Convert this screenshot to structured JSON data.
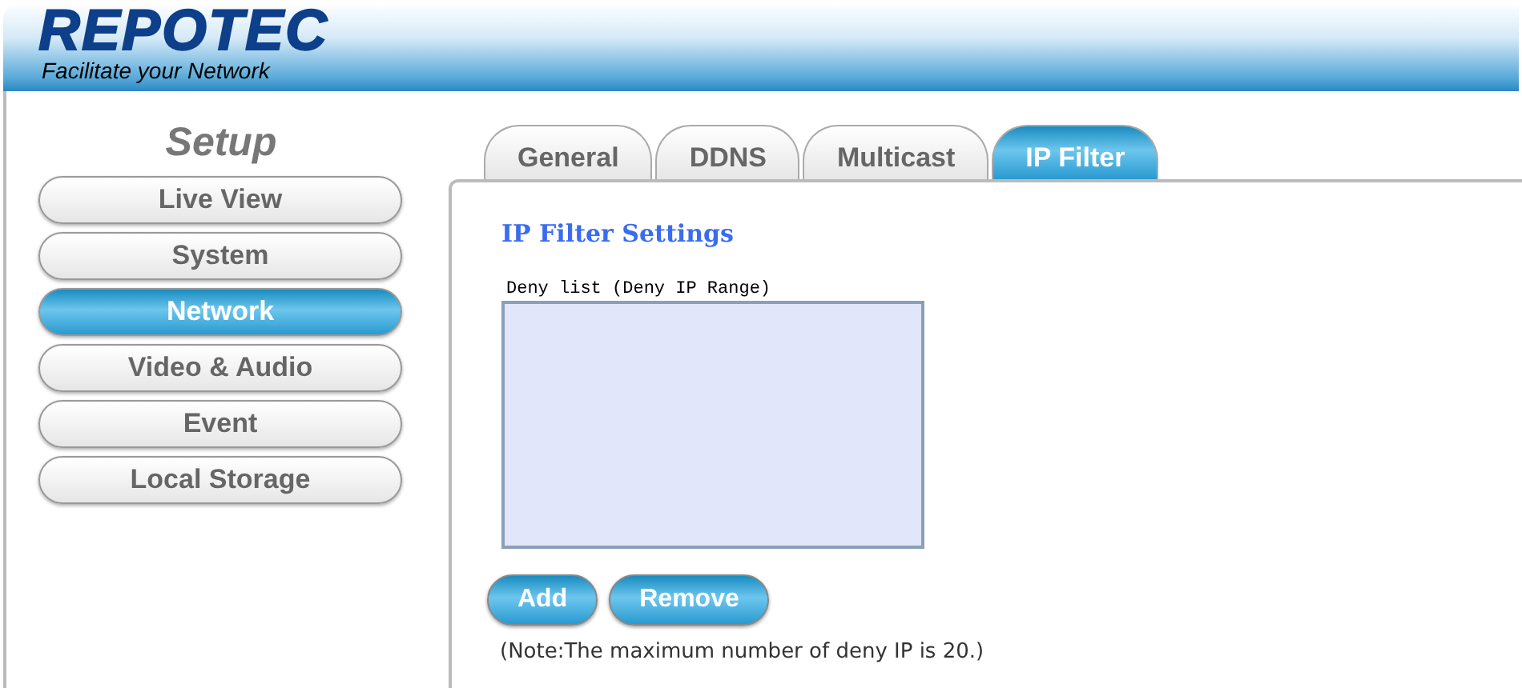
{
  "header": {
    "logo": "REPOTEC",
    "tagline": "Facilitate your Network"
  },
  "sidebar": {
    "title": "Setup",
    "items": [
      {
        "label": "Live View",
        "selected": false
      },
      {
        "label": "System",
        "selected": false
      },
      {
        "label": "Network",
        "selected": true
      },
      {
        "label": "Video & Audio",
        "selected": false
      },
      {
        "label": "Event",
        "selected": false
      },
      {
        "label": "Local Storage",
        "selected": false
      }
    ]
  },
  "tabs": [
    {
      "label": "General",
      "selected": false
    },
    {
      "label": "DDNS",
      "selected": false
    },
    {
      "label": "Multicast",
      "selected": false
    },
    {
      "label": "IP Filter",
      "selected": true
    }
  ],
  "panel": {
    "title": "IP Filter Settings",
    "list_label": "Deny list (Deny IP Range)",
    "buttons": [
      "Add",
      "Remove"
    ],
    "note": "(Note:The maximum number of deny IP is 20.)"
  }
}
